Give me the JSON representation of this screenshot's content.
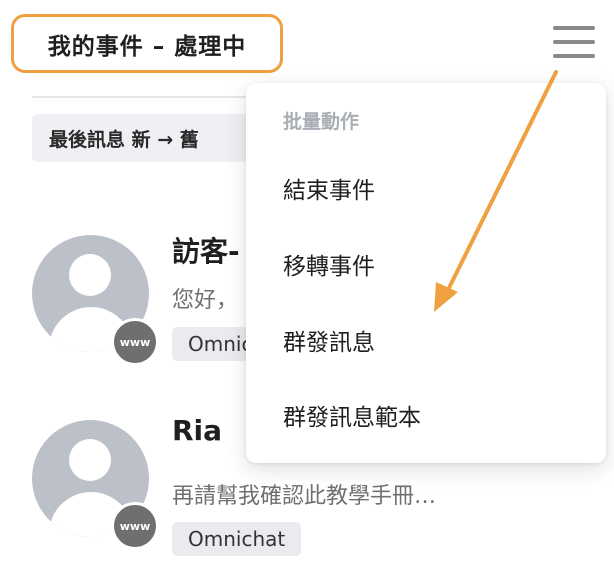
{
  "header": {
    "title": "我的事件 – 處理中",
    "menu_icon": "hamburger-menu-icon"
  },
  "sort": {
    "label": "最後訊息 新 → 舊"
  },
  "conversations": [
    {
      "name": "訪客-",
      "message": "您好，",
      "tag": "Omnic",
      "channel_badge": "www"
    },
    {
      "name": "Ria",
      "message": "再請幫我確認此教學手冊…",
      "tag": "Omnichat",
      "channel_badge": "www"
    }
  ],
  "menu": {
    "header": "批量動作",
    "items": [
      {
        "label": "結束事件"
      },
      {
        "label": "移轉事件"
      },
      {
        "label": "群發訊息"
      },
      {
        "label": "群發訊息範本"
      }
    ]
  },
  "colors": {
    "highlight_border": "#f0a040",
    "arrow": "#f0a040",
    "avatar_bg": "#bcc0c9",
    "tag_bg": "#e9ebef",
    "menu_header": "#a9adb5"
  }
}
